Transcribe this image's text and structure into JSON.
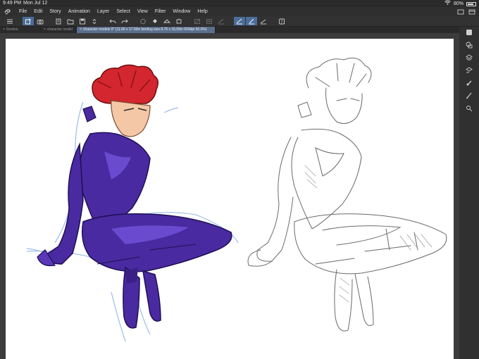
{
  "status_bar": {
    "time": "9:49 PM",
    "date": "Mon Jul 12",
    "battery_text": "80%",
    "battery_level": 0.8
  },
  "menu": {
    "items": [
      "File",
      "Edit",
      "Story",
      "Animation",
      "Layer",
      "Select",
      "View",
      "Filter",
      "Window",
      "Help"
    ]
  },
  "toolbar": {
    "buttons": [
      {
        "icon": "hamburger-icon"
      },
      {
        "icon": "new-canvas-icon",
        "active": true
      },
      {
        "icon": "camera-icon"
      },
      {
        "icon": "open-file-icon"
      },
      {
        "icon": "folder-icon"
      },
      {
        "icon": "save-icon"
      },
      {
        "icon": "stepper-icon"
      },
      {
        "icon": "undo-icon"
      },
      {
        "icon": "redo-icon"
      },
      {
        "icon": "select-icon"
      },
      {
        "icon": "fill-icon"
      },
      {
        "icon": "transform-icon"
      },
      {
        "icon": "crop-icon"
      },
      {
        "icon": "snap-off-icon",
        "dim": true
      },
      {
        "icon": "snap-grid-icon",
        "dim": true
      },
      {
        "icon": "snap-ruler-icon",
        "dim": true
      },
      {
        "icon": "ruler-icon",
        "active": true
      },
      {
        "icon": "ruler-edit-icon",
        "active": true
      },
      {
        "icon": "perspective-icon"
      },
      {
        "icon": "help-icon"
      }
    ]
  },
  "tabs": [
    {
      "label": "Gordon",
      "active": false
    },
    {
      "label": "character model",
      "active": false
    },
    {
      "label": "character models 9* (11.00 x 17.00in binding size:9.75 x 15.00in 600dpi 50.0%)",
      "active": true
    }
  ],
  "right_palette": {
    "icons": [
      "collapse-icon",
      "layer-properties-icon",
      "layers-icon",
      "navigator-icon",
      "color-mixer-icon",
      "brush-icon",
      "sub-tool-icon"
    ]
  },
  "colors": {
    "hair": "#d4262e",
    "suit": "#4a2aa0",
    "suit_light": "#6a4bd0",
    "accent_toolbar": "#4b6d9a",
    "active_tab": "#5a6f8e",
    "sketch_line": "#6a6a6a",
    "blue_pencil": "#8fb6e6"
  }
}
